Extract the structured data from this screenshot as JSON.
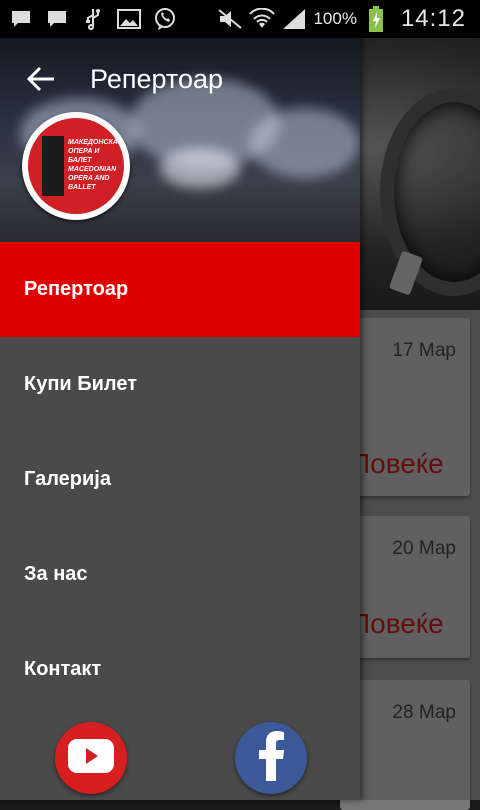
{
  "status_bar": {
    "icons": [
      "message-icon",
      "message-icon",
      "usb-icon",
      "gallery-icon",
      "viber-icon",
      "mute-icon",
      "wifi-icon",
      "signal-icon",
      "battery-charging-icon"
    ],
    "battery_percent": "100%",
    "time": "14:12"
  },
  "drawer": {
    "title": "Репертоар",
    "logo_text": [
      "МАКЕДОНСКА",
      "ОПЕРА И",
      "БАЛЕТ",
      "MACEDONIAN",
      "OPERA AND",
      "BALLET"
    ],
    "menu": [
      {
        "label": "Репертоар",
        "active": true
      },
      {
        "label": "Купи Билет",
        "active": false
      },
      {
        "label": "Галерија",
        "active": false
      },
      {
        "label": "За нас",
        "active": false
      },
      {
        "label": "Контакт",
        "active": false
      }
    ],
    "social": [
      "youtube-icon",
      "facebook-icon"
    ]
  },
  "background": {
    "events": [
      {
        "date": "17 Мар",
        "more": "Повеќе"
      },
      {
        "date": "20 Мар",
        "more": "Повеќе"
      },
      {
        "date": "28 Мар",
        "more": ""
      }
    ]
  },
  "colors": {
    "accent_red": "#e10000",
    "drawer_bg": "#4a4a4a",
    "youtube_red": "#d81e1e",
    "facebook_blue": "#3c5a99"
  }
}
